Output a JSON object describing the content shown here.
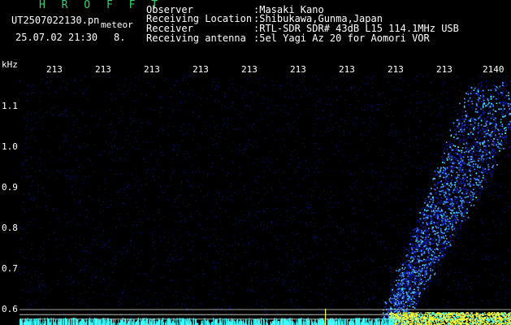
{
  "header": {
    "title": "H R O F F T",
    "filename": "UT2507022130.pn",
    "meteor_label": "meteor",
    "timestamp": "25.07.02 21:30",
    "count": "8."
  },
  "info": [
    {
      "label": "Observer",
      "value": ":Masaki Kano"
    },
    {
      "label": "Receiving Location",
      "value": ":Shibukawa,Gunma,Japan"
    },
    {
      "label": "Receiver",
      "value": ":RTL-SDR SDR# 43dB L15 114.1MHz USB"
    },
    {
      "label": "Receiving antenna",
      "value": ":5el Yagi Az 20 for Aomori VOR"
    }
  ],
  "chart_data": {
    "type": "heatmap",
    "ylabel": "kHz",
    "x_ticks": [
      "213",
      "213",
      "213",
      "213",
      "213",
      "213",
      "213",
      "213",
      "213",
      "2140"
    ],
    "y_ticks": [
      "1.1",
      "1.0",
      "0.9",
      "0.8",
      "0.7",
      "0.6"
    ],
    "ylim": [
      0.58,
      1.18
    ],
    "reference_lines_khz": [
      0.617,
      0.605,
      0.594
    ],
    "colors": {
      "background": "#000000",
      "noise": "#0a1aa8",
      "signal": "#4aa0ff",
      "strong": "#40ffff",
      "peak": "#ffff30",
      "reference_line": "#d8d8c8"
    }
  }
}
